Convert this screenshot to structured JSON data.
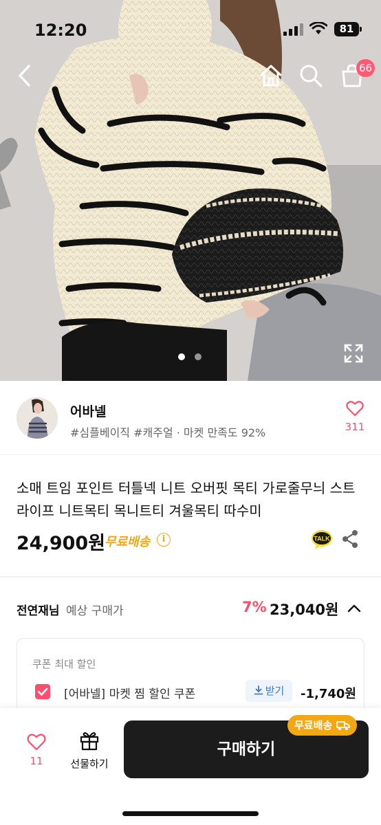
{
  "status_bar": {
    "time": "12:20",
    "battery": "81"
  },
  "nav": {
    "cart_badge": "66",
    "icons": [
      "back-icon",
      "home-icon",
      "search-icon",
      "cart-icon",
      "expand-icon"
    ]
  },
  "gallery": {
    "total_images": 2,
    "active_index": 0
  },
  "seller": {
    "name": "어바넬",
    "tags": "#심플베이직 #캐주얼 · 마켓 만족도 92%",
    "like_count": "311"
  },
  "product": {
    "title": "소매 트임 포인트 터틀넥 니트 오버핏 목티 가로줄무늬 스트라이프 니트목티 목니트티 겨울목티 따수미",
    "price": "24,900원",
    "shipping": "무료배송",
    "info_icon": "i",
    "talk_icon_text": "TALK"
  },
  "expected": {
    "user_name": "전연재님",
    "label": "예상 구매가",
    "discount_rate": "7%",
    "final_price": "23,040원"
  },
  "coupon": {
    "heading": "쿠폰 최대 할인",
    "name": "[어바넬] 마켓 찜 할인 쿠폰",
    "get_label": "받기",
    "amount": "-1,740원",
    "checked": true
  },
  "bottom_bar": {
    "like_count": "11",
    "gift_label": "선물하기",
    "buy_label": "구매하기",
    "free_ship_tag": "무료배송"
  },
  "colors": {
    "accent_pink": "#ff4d6d",
    "shipping_orange": "#f3a712",
    "buy_button": "#1c1c1c",
    "coupon_blue": "#3f78c9"
  }
}
